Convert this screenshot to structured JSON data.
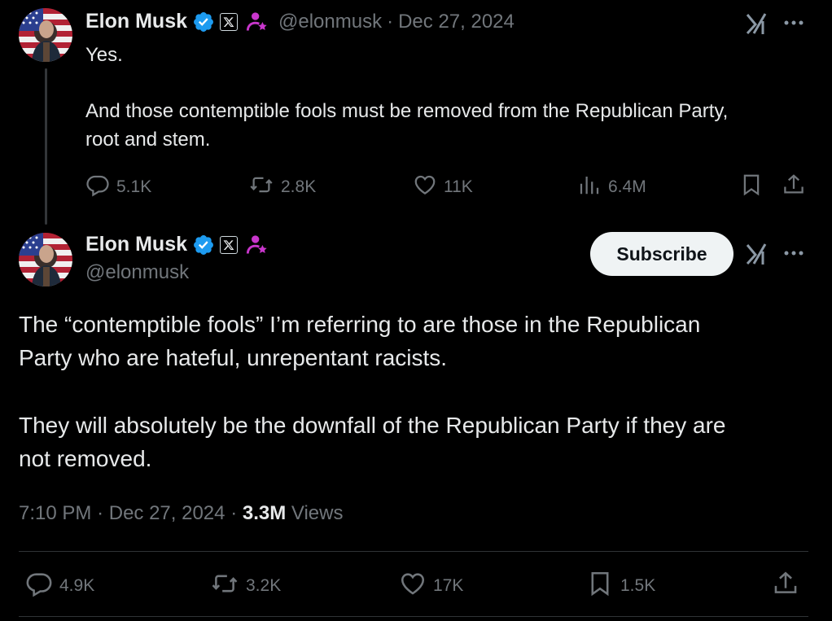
{
  "tweet1": {
    "name": "Elon Musk",
    "handle": "@elonmusk",
    "separator": "·",
    "date": "Dec 27, 2024",
    "text_line1": "Yes.",
    "text_line2": "And those contemptible fools must be removed from the Republican Party,",
    "text_line3": "root and stem.",
    "metrics": {
      "replies": "5.1K",
      "reposts": "2.8K",
      "likes": "11K",
      "views": "6.4M"
    }
  },
  "tweet2": {
    "name": "Elon Musk",
    "handle": "@elonmusk",
    "subscribe_label": "Subscribe",
    "text_line1": "The “contemptible fools” I’m referring to are those in the Republican",
    "text_line2": "Party who are hateful, unrepentant racists.",
    "text_line3": "They will absolutely be the downfall of the Republican Party if they are",
    "text_line4": "not removed.",
    "time": "7:10 PM",
    "sep1": "·",
    "date": "Dec 27, 2024",
    "sep2": "·",
    "views_count": "3.3M",
    "views_label": "Views",
    "metrics": {
      "replies": "4.9K",
      "reposts": "3.2K",
      "likes": "17K",
      "bookmarks": "1.5K"
    }
  },
  "colors": {
    "background": "#000000",
    "text": "#e7e9ea",
    "secondary": "#71767b",
    "verified": "#1d9bf0",
    "badge_pink": "#c936cc",
    "button_bg": "#eff3f4"
  }
}
